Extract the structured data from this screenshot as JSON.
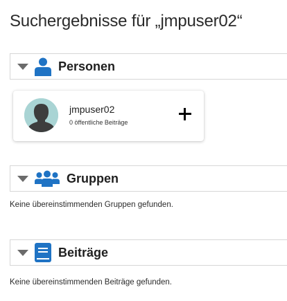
{
  "page": {
    "title": "Suchergebnisse für „jmpuser02“"
  },
  "sections": {
    "people": {
      "title": "Personen",
      "icon": "person-icon",
      "results": [
        {
          "name": "jmpuser02",
          "posts": "0 öffentliche Beiträge",
          "action_icon": "plus-icon"
        }
      ]
    },
    "groups": {
      "title": "Gruppen",
      "icon": "group-icon",
      "empty_message": "Keine übereinstimmenden Gruppen gefunden."
    },
    "posts": {
      "title": "Beiträge",
      "icon": "book-icon",
      "empty_message": "Keine übereinstimmenden Beiträge gefunden."
    }
  },
  "colors": {
    "icon_blue": "#1f73c4",
    "avatar_bg": "#a9d4d4",
    "avatar_silhouette": "#3d3d3d"
  }
}
